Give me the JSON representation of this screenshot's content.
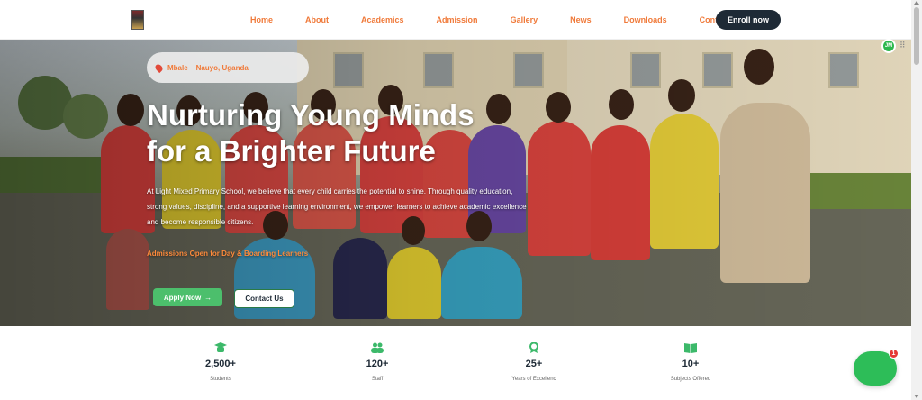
{
  "nav": {
    "items": [
      {
        "label": "Home"
      },
      {
        "label": "About"
      },
      {
        "label": "Academics"
      },
      {
        "label": "Admission"
      },
      {
        "label": "Gallery"
      },
      {
        "label": "News"
      },
      {
        "label": "Downloads"
      },
      {
        "label": "Contact"
      }
    ],
    "cta_label": "Enroll now"
  },
  "hero": {
    "location": "Mbale – Nauyo, Uganda",
    "title_line1": "Nurturing Young Minds",
    "title_line2": "for a Brighter Future",
    "description": "At Light Mixed Primary School, we believe that every child carries the potential to shine. Through quality education, strong values, discipline, and a supportive learning environment, we empower learners to achieve academic excellence and become responsible citizens.",
    "admissions": "Admissions Open for Day & Boarding Learners",
    "apply_label": "Apply Now",
    "contact_label": "Contact Us"
  },
  "user_badge": "JM",
  "stats": [
    {
      "icon": "graduate-icon",
      "value": "2,500+",
      "label": "Students"
    },
    {
      "icon": "staff-icon",
      "value": "120+",
      "label": "Staff"
    },
    {
      "icon": "award-icon",
      "value": "25+",
      "label": "Years of Excellenc"
    },
    {
      "icon": "book-icon",
      "value": "10+",
      "label": "Subjects Offered"
    }
  ],
  "chat": {
    "badge": "1"
  },
  "colors": {
    "accent": "#f07a3a",
    "primary_dark": "#1e2a36",
    "green": "#4cbf6c"
  }
}
